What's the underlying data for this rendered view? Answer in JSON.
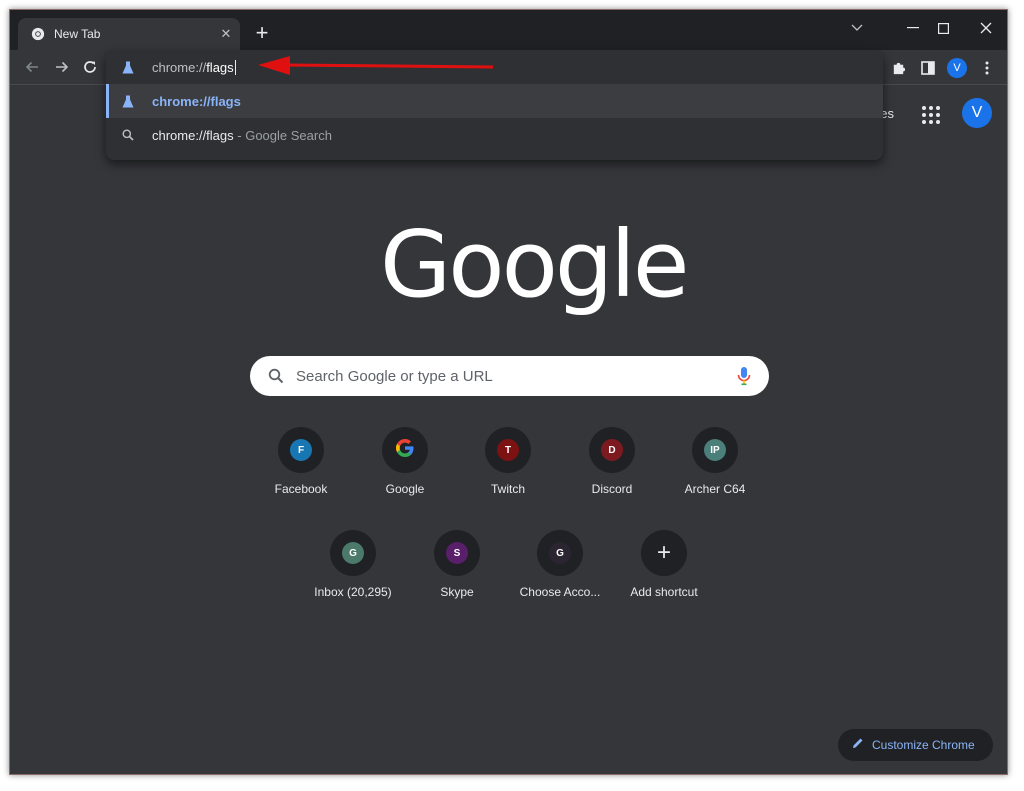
{
  "tab": {
    "title": "New Tab",
    "favicon": "chrome-icon"
  },
  "omnibox": {
    "typed_prefix": "chrome://",
    "typed_highlight": "flags",
    "suggestions": [
      {
        "icon": "flask-icon",
        "text": "chrome://flags",
        "suffix": ""
      },
      {
        "icon": "search-icon",
        "text": "chrome://flags",
        "suffix": " - Google Search"
      }
    ]
  },
  "header": {
    "gmail_partial": "ges",
    "avatar_letter": "V"
  },
  "toolbar": {
    "avatar_letter": "V"
  },
  "logo": {
    "text": "Google"
  },
  "search": {
    "placeholder": "Search Google or type a URL"
  },
  "shortcuts": [
    {
      "label": "Facebook",
      "letter": "F",
      "color": "#1877b2"
    },
    {
      "label": "Google",
      "letter": "G",
      "color": "google"
    },
    {
      "label": "Twitch",
      "letter": "T",
      "color": "#7d1212"
    },
    {
      "label": "Discord",
      "letter": "D",
      "color": "#7d1a1f"
    },
    {
      "label": "Archer C64",
      "letter": "IP",
      "color": "#4a7f7a"
    },
    {
      "label": "Inbox (20,295)",
      "letter": "G",
      "color": "#4c7a6a"
    },
    {
      "label": "Skype",
      "letter": "S",
      "color": "#5a1f6a"
    },
    {
      "label": "Choose Acco...",
      "letter": "G",
      "color": "#2b2532"
    },
    {
      "label": "Add shortcut",
      "letter": "+",
      "color": "none"
    }
  ],
  "customize": {
    "label": "Customize Chrome"
  },
  "colors": {
    "accent": "#8ab4f8",
    "annotation_arrow": "#e01010",
    "background": "#35363a"
  }
}
